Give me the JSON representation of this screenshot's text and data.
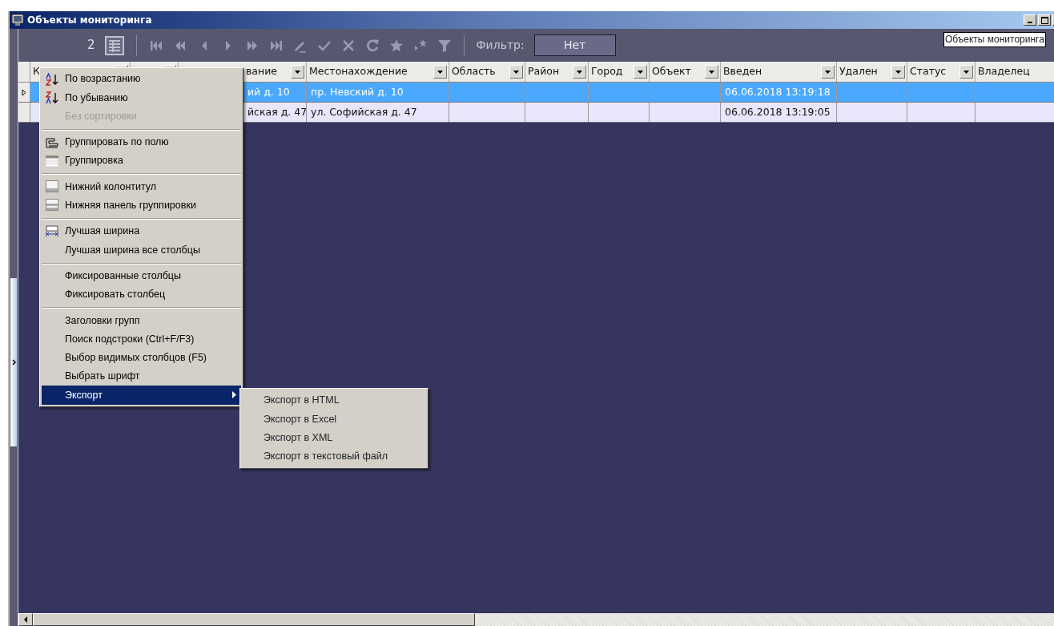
{
  "window": {
    "title": "Объекты мониторинга"
  },
  "toolbar": {
    "page_count": "2",
    "filter_label": "Фильтр:",
    "filter_value": "Нет"
  },
  "tooltip": "Объекты мониторинга",
  "table": {
    "columns": [
      {
        "label": "К"
      },
      {},
      {
        "label": "вание"
      },
      {
        "label": "Местонахождение"
      },
      {
        "label": "Область"
      },
      {
        "label": "Район"
      },
      {
        "label": "Город"
      },
      {
        "label": "Объект"
      },
      {
        "label": "Введен"
      },
      {
        "label": "Удален"
      },
      {
        "label": "Статус"
      },
      {
        "label": "Владелец"
      }
    ],
    "rows": [
      {
        "selected": true,
        "column_3": "ий д. 10",
        "location": "пр. Невский д. 10",
        "entered": "06.06.2018 13:19:18"
      },
      {
        "selected": false,
        "column_3": "йская д. 47",
        "location": "ул. Софийская д. 47",
        "entered": "06.06.2018 13:19:05"
      }
    ]
  },
  "context_menu": {
    "groups": [
      [
        {
          "label": "По возрастанию",
          "disabled": false,
          "selected": false
        },
        {
          "label": "По убыванию",
          "disabled": false,
          "selected": false
        },
        {
          "label": "Без сортировки",
          "disabled": true,
          "selected": false
        }
      ],
      [
        {
          "label": "Группировать по полю",
          "disabled": false,
          "selected": false
        },
        {
          "label": "Группировка",
          "disabled": false,
          "selected": false
        }
      ],
      [
        {
          "label": "Нижний колонтитул",
          "disabled": false,
          "selected": false
        },
        {
          "label": "Нижняя панель группировки",
          "disabled": false,
          "selected": false
        }
      ],
      [
        {
          "label": "Лучшая ширина",
          "disabled": false,
          "selected": false
        },
        {
          "label": "Лучшая ширина все столбцы",
          "disabled": false,
          "selected": false
        }
      ],
      [
        {
          "label": "Фиксированные столбцы",
          "disabled": false,
          "selected": false
        },
        {
          "label": "Фиксировать столбец",
          "disabled": false,
          "selected": false
        }
      ],
      [
        {
          "label": "Заголовки групп",
          "disabled": false,
          "selected": false
        },
        {
          "label": "Поиск подстроки (Ctrl+F/F3)",
          "disabled": false,
          "selected": false
        },
        {
          "label": "Выбор видимых столбцов (F5)",
          "disabled": false,
          "selected": false
        },
        {
          "label": "Выбрать шрифт",
          "disabled": false,
          "selected": false
        },
        {
          "label": "Экспорт",
          "disabled": false,
          "selected": true,
          "submenu": [
            {
              "label": "Экспорт в HTML"
            },
            {
              "label": "Экспорт в Excel"
            },
            {
              "label": "Экспорт в XML"
            },
            {
              "label": "Экспорт в текстовый файл"
            }
          ]
        }
      ]
    ]
  }
}
